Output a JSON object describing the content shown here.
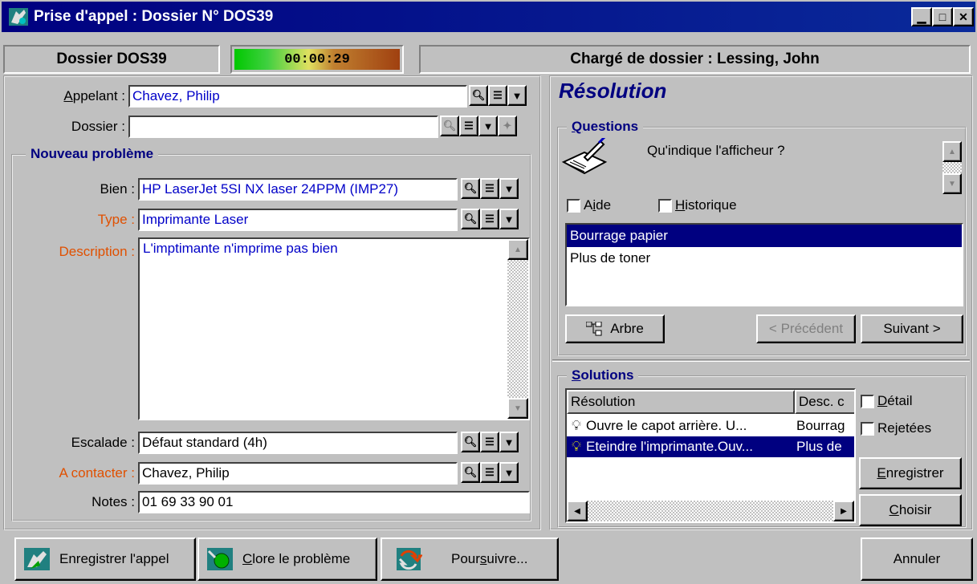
{
  "window": {
    "title": "Prise d'appel : Dossier N° DOS39"
  },
  "status": {
    "dossier": "Dossier DOS39",
    "timer": "00:00:29",
    "manager": "Chargé de dossier : Lessing, John"
  },
  "caller": {
    "appelant_label": "Appelant :",
    "appelant_value": "Chavez, Philip",
    "dossier_label": "Dossier :",
    "dossier_value": ""
  },
  "problem": {
    "group_title": "Nouveau problème",
    "bien_label": "Bien :",
    "bien_value": "HP LaserJet 5SI NX laser 24PPM (IMP27)",
    "type_label": "Type :",
    "type_value": "Imprimante Laser",
    "description_label": "Description :",
    "description_value": "L'imptimante n'imprime pas bien",
    "escalade_label": "Escalade :",
    "escalade_value": "Défaut standard (4h)",
    "contact_label": "A contacter :",
    "contact_value": "Chavez, Philip",
    "notes_label": "Notes :",
    "notes_value": "01 69 33 90 01"
  },
  "resolution": {
    "title": "Résolution",
    "questions_title": "Questions",
    "question_text": "Qu'indique l'afficheur ?",
    "aide_label": "Aide",
    "historique_label": "Historique",
    "answers": [
      "Bourrage papier",
      "Plus de toner"
    ],
    "arbre_label": "Arbre",
    "precedent_label": "< Précédent",
    "suivant_label": "Suivant >",
    "solutions_title": "Solutions",
    "col_resolution": "Résolution",
    "col_desc": "Desc. c",
    "rows": [
      {
        "resolution": "Ouvre le capot arrière. U...",
        "desc": "Bourrag"
      },
      {
        "resolution": "Eteindre l'imprimante.Ouv...",
        "desc": "Plus de"
      }
    ],
    "detail_label": "Détail",
    "rejetees_label": "Rejetées",
    "enregistrer_label": "Enregistrer",
    "choisir_label": "Choisir"
  },
  "footer": {
    "save_call_label": "Enregistrer l'appel",
    "close_problem_label": "Clore le problème",
    "continue_label": "Poursuivre...",
    "cancel_label": "Annuler"
  }
}
